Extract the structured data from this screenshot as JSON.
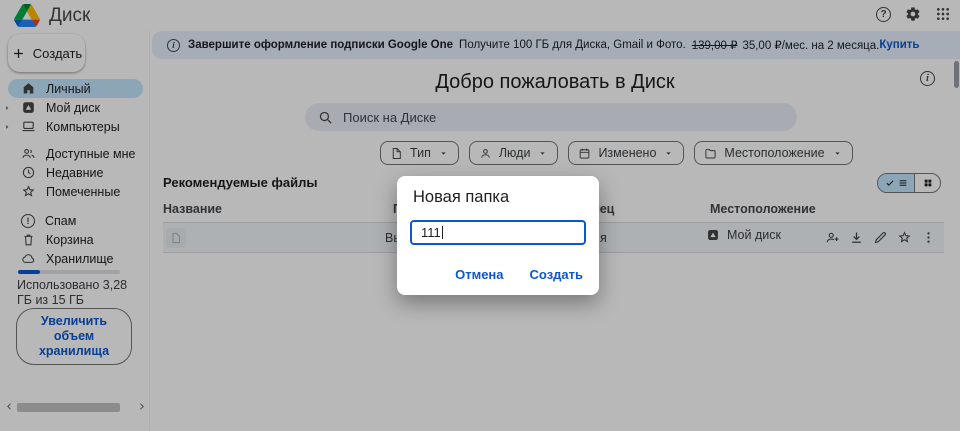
{
  "colors": {
    "accent_blue": "#0b57d0",
    "banner_bg": "#e8f0fe",
    "selected_pill": "#c2e7ff",
    "scrim": "rgba(0,0,0,0.28)"
  },
  "topbar": {
    "app_title": "Диск"
  },
  "banner": {
    "title_bold": "Завершите оформление подписки Google One",
    "message": "Получите 100 ГБ для Диска, Gmail и Фото.",
    "old_price": "139,00 ₽",
    "new_price": "35,00 ₽/мес. на 2 месяца.",
    "buy_label": "Купить"
  },
  "sidebar": {
    "create_label": "Создать",
    "items": [
      {
        "label": "Личный",
        "icon": "home",
        "selected": true
      },
      {
        "label": "Мой диск",
        "icon": "drive",
        "expandable": true
      },
      {
        "label": "Компьютеры",
        "icon": "computer",
        "expandable": true
      },
      {
        "label": "Доступные мне",
        "icon": "people"
      },
      {
        "label": "Недавние",
        "icon": "clock"
      },
      {
        "label": "Помеченные",
        "icon": "star"
      },
      {
        "label": "Спам",
        "icon": "spam"
      },
      {
        "label": "Корзина",
        "icon": "trash"
      },
      {
        "label": "Хранилище",
        "icon": "cloud"
      }
    ],
    "storage": {
      "used_percent": 22,
      "usage_text": "Использовано 3,28 ГБ из 15 ГБ",
      "upgrade_label": "Увеличить объем хранилища"
    }
  },
  "main": {
    "welcome_title": "Добро пожаловать в Диск",
    "search_placeholder": "Поиск на Диске",
    "filter_chips": [
      {
        "label": "Тип",
        "icon": "file"
      },
      {
        "label": "Люди",
        "icon": "person"
      },
      {
        "label": "Изменено",
        "icon": "calendar"
      },
      {
        "label": "Местоположение",
        "icon": "folder"
      }
    ],
    "section_title": "Рекомендуемые файлы",
    "table": {
      "headers": [
        "Название",
        "По",
        "елец",
        "Местоположение"
      ],
      "row": {
        "reason_fragment": "Вы",
        "owner_fragment": "я",
        "location": "Мой диск",
        "actions": [
          "share-person-add",
          "download",
          "rename",
          "star",
          "more"
        ]
      }
    }
  },
  "dialog": {
    "title": "Новая папка",
    "input_value": "111",
    "cancel_label": "Отмена",
    "create_label": "Создать"
  }
}
